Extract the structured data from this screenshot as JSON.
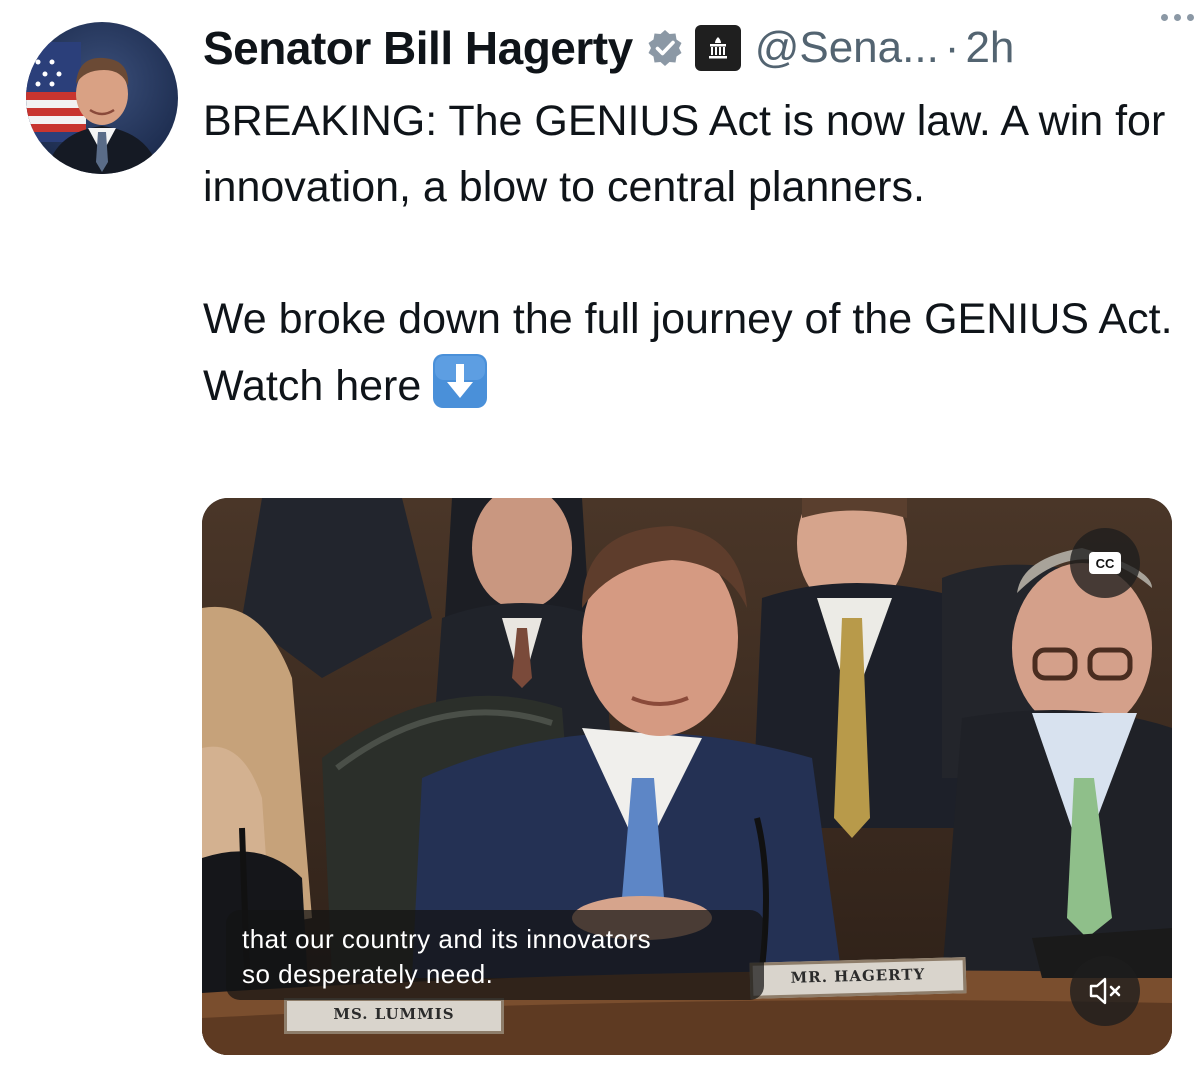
{
  "tweet": {
    "author": {
      "display_name": "Senator Bill Hagerty",
      "handle": "@Sena...",
      "verified_badge_icon": "verified-check-icon",
      "affiliation_badge_icon": "government-building-icon"
    },
    "separator": "·",
    "timestamp": "2h",
    "more_icon": "more-options-icon",
    "text": {
      "paragraph1": "BREAKING: The GENIUS Act is now law. A win for innovation, a blow to central planners.",
      "paragraph2": "We broke down the full journey of the GENIUS Act. Watch here",
      "emoji": "down-arrow-button-emoji"
    }
  },
  "video": {
    "cc_label": "CC",
    "mute_icon": "speaker-muted-icon",
    "caption_line1": "that our country and its innovators",
    "caption_line2": "so desperately need.",
    "nameplate_left": "MS. LUMMIS",
    "nameplate_center": "MR. HAGERTY"
  },
  "colors": {
    "verified_blue": "#1d9bf0",
    "secondary_text": "#536471",
    "primary_text": "#0f1419"
  }
}
